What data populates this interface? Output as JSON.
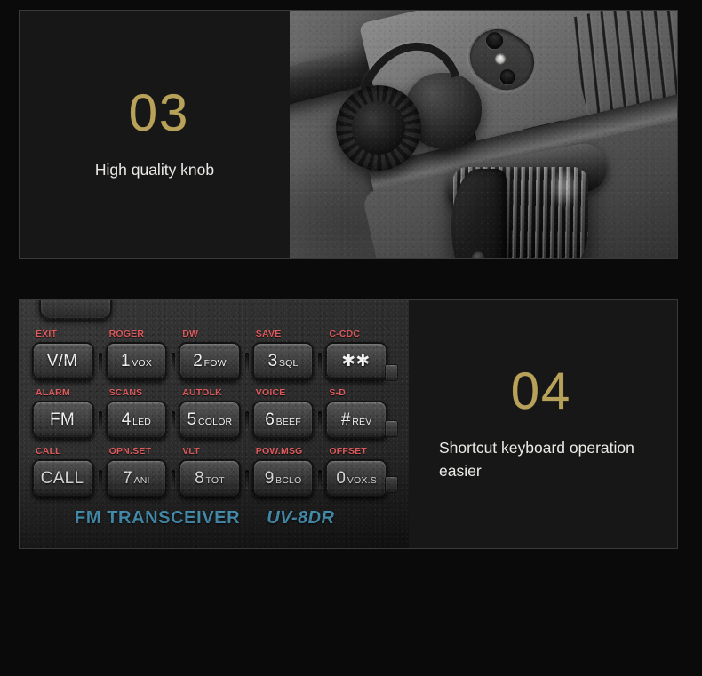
{
  "colors": {
    "page_background": "#0a0a0a",
    "panel_background": "#171717",
    "panel_border": "#3a3a3a",
    "number_gold": "#b8a159",
    "caption_white": "#eceae6",
    "key_function_red": "#e0595c",
    "brand_blue": "#5fc3f0"
  },
  "panels": [
    {
      "number": "03",
      "caption": "High quality knob",
      "photo_alt": "close-up of radio rotary knob"
    },
    {
      "number": "04",
      "caption": "Shortcut keyboard operation easier",
      "photo_alt": "close-up of radio keypad"
    }
  ],
  "keypad": {
    "rows": [
      [
        {
          "function": "EXIT",
          "main": "V/M",
          "sub": ""
        },
        {
          "function": "ROGER",
          "main": "1",
          "sub": "VOX"
        },
        {
          "function": "DW",
          "main": "2",
          "sub": "FOW"
        },
        {
          "function": "SAVE",
          "main": "3",
          "sub": "SQL"
        },
        {
          "function": "C-CDC",
          "main": "✱✱",
          "sub": ""
        }
      ],
      [
        {
          "function": "ALARM",
          "main": "FM",
          "sub": ""
        },
        {
          "function": "SCANS",
          "main": "4",
          "sub": "LED"
        },
        {
          "function": "AUTOLK",
          "main": "5",
          "sub": "COLOR"
        },
        {
          "function": "VOICE",
          "main": "6",
          "sub": "BEEF"
        },
        {
          "function": "S-D",
          "main": "#",
          "sub": "REV"
        }
      ],
      [
        {
          "function": "CALL",
          "main": "CALL",
          "sub": ""
        },
        {
          "function": "OPN.SET",
          "main": "7",
          "sub": "ANI"
        },
        {
          "function": "VLT",
          "main": "8",
          "sub": "TOT"
        },
        {
          "function": "POW.MSG",
          "main": "9",
          "sub": "BCLO"
        },
        {
          "function": "OFFSET",
          "main": "0",
          "sub": "VOX.S"
        }
      ]
    ],
    "brand": {
      "type_label": "FM TRANSCEIVER",
      "model": "UV-8DR"
    }
  }
}
